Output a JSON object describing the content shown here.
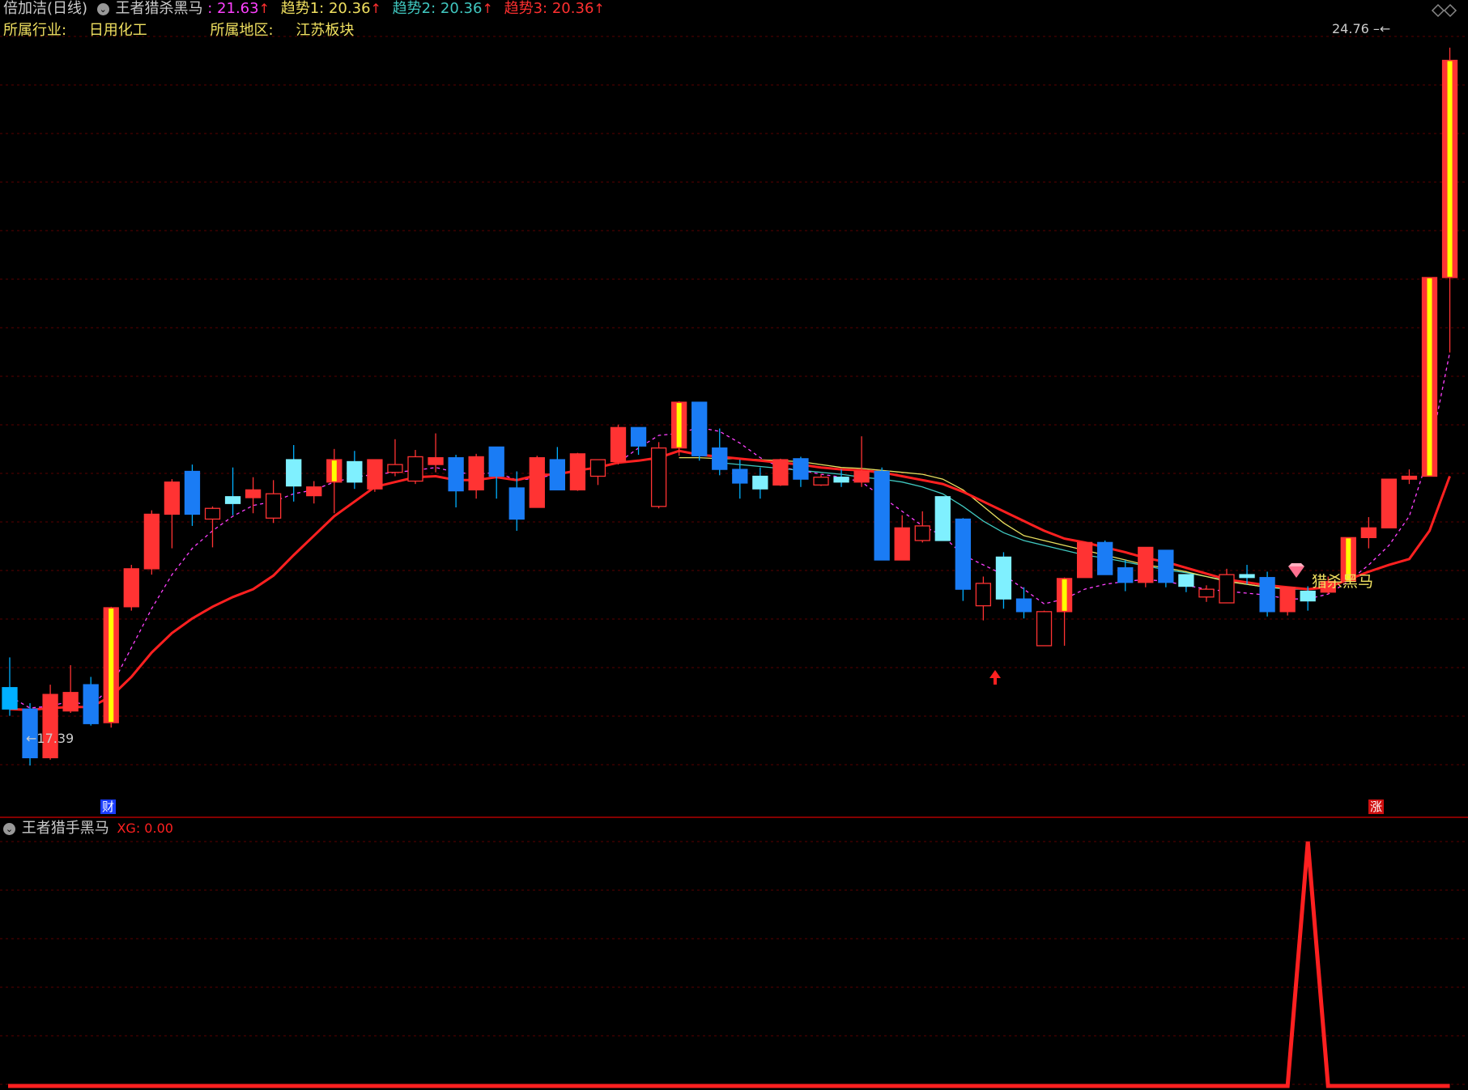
{
  "header": {
    "stock": "倍加洁(日线)",
    "indicator": "王者猎杀黑马",
    "main_value": ": 21.63",
    "trend1_label": "趋势1:",
    "trend1_value": "20.36",
    "trend2_label": "趋势2:",
    "trend2_value": "20.36",
    "trend3_label": "趋势3:",
    "trend3_value": "20.36",
    "up_arrow": "↑"
  },
  "info": {
    "industry_label": "所属行业:",
    "industry_value": "日用化工",
    "region_label": "所属地区:",
    "region_value": "江苏板块"
  },
  "annotations": {
    "high_label": "24.76",
    "low_label": "17.39",
    "signal_label": "猎杀黑马",
    "cai_badge": "财",
    "zhang_badge": "涨",
    "diamond_icon": "diamond-icon"
  },
  "sub_panel": {
    "title": "王者猎手黑马",
    "xg_label": "XG: 0.00"
  },
  "colors": {
    "up": "#ff3333",
    "down": "#00b0ff",
    "down_fill": "#1a7cf5",
    "down_light": "#7ff0ff",
    "limit_up": "#ffff00",
    "ma_red": "#ff2020",
    "ma_yellow": "#e8e060",
    "ma_teal": "#40c8c0",
    "ma_magenta": "#ff40ff",
    "grid": "#5a0000",
    "gold_text": "#f0e060"
  },
  "chart_data": {
    "type": "candlestick",
    "ylim": [
      16.9,
      25.0
    ],
    "sub_ylim": [
      0,
      1
    ],
    "candles": [
      {
        "o": 18.19,
        "h": 18.5,
        "l": 17.9,
        "c": 17.97,
        "k": "down"
      },
      {
        "o": 17.97,
        "h": 18.03,
        "l": 17.39,
        "c": 17.47,
        "k": "downf"
      },
      {
        "o": 17.47,
        "h": 18.22,
        "l": 17.45,
        "c": 18.12,
        "k": "up"
      },
      {
        "o": 18.14,
        "h": 18.42,
        "l": 17.93,
        "c": 17.95,
        "k": "up"
      },
      {
        "o": 18.22,
        "h": 18.3,
        "l": 17.8,
        "c": 17.82,
        "k": "downf"
      },
      {
        "o": 17.83,
        "h": 19.02,
        "l": 17.78,
        "c": 19.01,
        "k": "limit"
      },
      {
        "o": 19.02,
        "h": 19.45,
        "l": 18.98,
        "c": 19.41,
        "k": "up"
      },
      {
        "o": 19.41,
        "h": 20.01,
        "l": 19.35,
        "c": 19.97,
        "k": "up"
      },
      {
        "o": 19.97,
        "h": 20.33,
        "l": 19.62,
        "c": 20.3,
        "k": "up"
      },
      {
        "o": 20.41,
        "h": 20.48,
        "l": 19.85,
        "c": 19.97,
        "k": "downf"
      },
      {
        "o": 19.92,
        "h": 20.05,
        "l": 19.63,
        "c": 20.03,
        "k": "hollow"
      },
      {
        "o": 20.08,
        "h": 20.45,
        "l": 19.96,
        "c": 20.15,
        "k": "downl"
      },
      {
        "o": 20.14,
        "h": 20.35,
        "l": 19.98,
        "c": 20.22,
        "k": "up"
      },
      {
        "o": 19.93,
        "h": 20.32,
        "l": 19.88,
        "c": 20.18,
        "k": "hollow"
      },
      {
        "o": 20.53,
        "h": 20.68,
        "l": 20.1,
        "c": 20.26,
        "k": "downl"
      },
      {
        "o": 20.16,
        "h": 20.31,
        "l": 20.08,
        "c": 20.25,
        "k": "up"
      },
      {
        "o": 20.3,
        "h": 20.64,
        "l": 19.98,
        "c": 20.53,
        "k": "limit"
      },
      {
        "o": 20.51,
        "h": 20.62,
        "l": 20.23,
        "c": 20.3,
        "k": "downl"
      },
      {
        "o": 20.23,
        "h": 20.53,
        "l": 20.2,
        "c": 20.53,
        "k": "up"
      },
      {
        "o": 20.4,
        "h": 20.74,
        "l": 20.36,
        "c": 20.48,
        "k": "hollow"
      },
      {
        "o": 20.31,
        "h": 20.63,
        "l": 20.28,
        "c": 20.56,
        "k": "hollow"
      },
      {
        "o": 20.48,
        "h": 20.8,
        "l": 20.4,
        "c": 20.55,
        "k": "up"
      },
      {
        "o": 20.55,
        "h": 20.58,
        "l": 20.04,
        "c": 20.21,
        "k": "downf"
      },
      {
        "o": 20.22,
        "h": 20.59,
        "l": 20.13,
        "c": 20.56,
        "k": "up"
      },
      {
        "o": 20.66,
        "h": 20.66,
        "l": 20.13,
        "c": 20.36,
        "k": "downf"
      },
      {
        "o": 20.24,
        "h": 20.41,
        "l": 19.8,
        "c": 19.92,
        "k": "downf"
      },
      {
        "o": 20.04,
        "h": 20.57,
        "l": 20.04,
        "c": 20.55,
        "k": "up"
      },
      {
        "o": 20.53,
        "h": 20.66,
        "l": 20.22,
        "c": 20.22,
        "k": "downf"
      },
      {
        "o": 20.22,
        "h": 20.6,
        "l": 20.21,
        "c": 20.59,
        "k": "up"
      },
      {
        "o": 20.36,
        "h": 20.53,
        "l": 20.27,
        "c": 20.53,
        "k": "hollow"
      },
      {
        "o": 20.51,
        "h": 20.89,
        "l": 20.48,
        "c": 20.86,
        "k": "up"
      },
      {
        "o": 20.86,
        "h": 20.86,
        "l": 20.58,
        "c": 20.67,
        "k": "downf"
      },
      {
        "o": 20.05,
        "h": 20.71,
        "l": 20.03,
        "c": 20.65,
        "k": "hollow"
      },
      {
        "o": 20.65,
        "h": 21.13,
        "l": 20.57,
        "c": 21.12,
        "k": "limit"
      },
      {
        "o": 21.12,
        "h": 21.12,
        "l": 20.52,
        "c": 20.57,
        "k": "downf"
      },
      {
        "o": 20.65,
        "h": 20.85,
        "l": 20.37,
        "c": 20.43,
        "k": "downf"
      },
      {
        "o": 20.43,
        "h": 20.53,
        "l": 20.13,
        "c": 20.29,
        "k": "downf"
      },
      {
        "o": 20.36,
        "h": 20.45,
        "l": 20.13,
        "c": 20.23,
        "k": "downl"
      },
      {
        "o": 20.27,
        "h": 20.54,
        "l": 20.26,
        "c": 20.53,
        "k": "up"
      },
      {
        "o": 20.54,
        "h": 20.56,
        "l": 20.25,
        "c": 20.33,
        "k": "downf"
      },
      {
        "o": 20.27,
        "h": 20.38,
        "l": 20.26,
        "c": 20.35,
        "k": "hollow"
      },
      {
        "o": 20.35,
        "h": 20.43,
        "l": 20.25,
        "c": 20.3,
        "k": "downl"
      },
      {
        "o": 20.3,
        "h": 20.77,
        "l": 20.25,
        "c": 20.41,
        "k": "up"
      },
      {
        "o": 20.41,
        "h": 20.45,
        "l": 19.5,
        "c": 19.5,
        "k": "downf"
      },
      {
        "o": 19.5,
        "h": 19.96,
        "l": 19.5,
        "c": 19.83,
        "k": "up"
      },
      {
        "o": 19.7,
        "h": 20.0,
        "l": 19.68,
        "c": 19.85,
        "k": "hollow"
      },
      {
        "o": 20.15,
        "h": 20.15,
        "l": 19.7,
        "c": 19.7,
        "k": "downl"
      },
      {
        "o": 19.92,
        "h": 19.93,
        "l": 19.08,
        "c": 19.2,
        "k": "downf"
      },
      {
        "o": 19.03,
        "h": 19.33,
        "l": 18.88,
        "c": 19.26,
        "k": "hollow"
      },
      {
        "o": 19.53,
        "h": 19.58,
        "l": 19.0,
        "c": 19.1,
        "k": "downl"
      },
      {
        "o": 19.1,
        "h": 19.22,
        "l": 18.9,
        "c": 18.97,
        "k": "downf"
      },
      {
        "o": 18.62,
        "h": 18.98,
        "l": 18.62,
        "c": 18.97,
        "k": "hollow"
      },
      {
        "o": 18.97,
        "h": 19.32,
        "l": 18.62,
        "c": 19.31,
        "k": "limit"
      },
      {
        "o": 19.32,
        "h": 19.67,
        "l": 19.32,
        "c": 19.68,
        "k": "up"
      },
      {
        "o": 19.68,
        "h": 19.7,
        "l": 19.36,
        "c": 19.35,
        "k": "downf"
      },
      {
        "o": 19.42,
        "h": 19.5,
        "l": 19.18,
        "c": 19.27,
        "k": "downf"
      },
      {
        "o": 19.63,
        "h": 19.63,
        "l": 19.22,
        "c": 19.27,
        "k": "up"
      },
      {
        "o": 19.27,
        "h": 19.6,
        "l": 19.22,
        "c": 19.6,
        "k": "downf"
      },
      {
        "o": 19.35,
        "h": 19.35,
        "l": 19.17,
        "c": 19.23,
        "k": "downl"
      },
      {
        "o": 19.12,
        "h": 19.24,
        "l": 19.07,
        "c": 19.2,
        "k": "hollow"
      },
      {
        "o": 19.06,
        "h": 19.41,
        "l": 19.06,
        "c": 19.35,
        "k": "hollow"
      },
      {
        "o": 19.35,
        "h": 19.45,
        "l": 19.25,
        "c": 19.32,
        "k": "downl"
      },
      {
        "o": 19.32,
        "h": 19.38,
        "l": 18.92,
        "c": 18.97,
        "k": "downf"
      },
      {
        "o": 18.97,
        "h": 19.22,
        "l": 18.93,
        "c": 19.22,
        "k": "up"
      },
      {
        "o": 19.18,
        "h": 19.23,
        "l": 18.98,
        "c": 19.08,
        "k": "downl"
      },
      {
        "o": 19.17,
        "h": 19.33,
        "l": 19.15,
        "c": 19.28,
        "k": "up"
      },
      {
        "o": 19.28,
        "h": 19.73,
        "l": 19.28,
        "c": 19.73,
        "k": "limit"
      },
      {
        "o": 19.73,
        "h": 19.94,
        "l": 19.62,
        "c": 19.83,
        "k": "up"
      },
      {
        "o": 19.83,
        "h": 20.33,
        "l": 19.83,
        "c": 20.33,
        "k": "up"
      },
      {
        "o": 20.33,
        "h": 20.43,
        "l": 20.28,
        "c": 20.36,
        "k": "up"
      },
      {
        "o": 20.36,
        "h": 22.4,
        "l": 20.36,
        "c": 22.4,
        "k": "limit"
      },
      {
        "o": 22.4,
        "h": 24.76,
        "l": 21.63,
        "c": 24.63,
        "k": "limit"
      }
    ],
    "ma_red": [
      17.97,
      17.96,
      17.98,
      17.99,
      17.99,
      18.1,
      18.3,
      18.55,
      18.75,
      18.9,
      19.02,
      19.12,
      19.2,
      19.34,
      19.55,
      19.75,
      19.95,
      20.1,
      20.25,
      20.3,
      20.35,
      20.36,
      20.32,
      20.32,
      20.35,
      20.32,
      20.37,
      20.38,
      20.42,
      20.45,
      20.5,
      20.52,
      20.55,
      20.62,
      20.58,
      20.56,
      20.54,
      20.52,
      20.5,
      20.48,
      20.45,
      20.43,
      20.42,
      20.4,
      20.36,
      20.32,
      20.28,
      20.2,
      20.1,
      20.0,
      19.9,
      19.8,
      19.72,
      19.68,
      19.63,
      19.58,
      19.52,
      19.48,
      19.42,
      19.36,
      19.3,
      19.27,
      19.24,
      19.22,
      19.2,
      19.22,
      19.3,
      19.38,
      19.45,
      19.51,
      19.8,
      20.36
    ],
    "ma_yellow": [
      null,
      null,
      null,
      null,
      null,
      null,
      null,
      null,
      null,
      null,
      null,
      null,
      null,
      null,
      null,
      null,
      null,
      null,
      null,
      null,
      null,
      null,
      null,
      null,
      null,
      null,
      null,
      null,
      null,
      null,
      null,
      null,
      null,
      20.55,
      20.55,
      20.54,
      20.54,
      20.53,
      20.52,
      20.51,
      20.48,
      20.45,
      20.44,
      20.42,
      20.4,
      20.38,
      20.33,
      20.22,
      20.05,
      19.88,
      19.75,
      19.7,
      19.65,
      19.6,
      19.55,
      19.5,
      19.45,
      19.42,
      19.38,
      19.33,
      19.28,
      19.25,
      19.22,
      19.21,
      19.2,
      19.22,
      null,
      null,
      null,
      null,
      null,
      null
    ],
    "ma_teal": [
      null,
      null,
      null,
      null,
      null,
      null,
      null,
      null,
      null,
      null,
      null,
      null,
      null,
      null,
      null,
      null,
      null,
      null,
      null,
      null,
      null,
      null,
      null,
      null,
      null,
      null,
      null,
      null,
      null,
      null,
      null,
      null,
      null,
      null,
      null,
      20.5,
      20.48,
      20.46,
      20.44,
      20.42,
      20.4,
      20.38,
      20.35,
      20.33,
      20.3,
      20.25,
      20.18,
      20.05,
      19.9,
      19.78,
      19.7,
      19.65,
      19.6,
      19.55,
      19.52,
      19.48,
      19.44,
      19.4,
      19.37,
      19.33,
      19.29,
      19.25,
      19.22,
      19.2,
      19.2,
      null,
      null,
      null,
      null,
      null,
      null,
      null
    ],
    "ma_magenta": [
      18.1,
      17.98,
      18.0,
      18.05,
      18.0,
      18.2,
      18.6,
      19.0,
      19.35,
      19.62,
      19.8,
      19.95,
      20.06,
      20.1,
      20.18,
      20.22,
      20.3,
      20.35,
      20.38,
      20.4,
      20.42,
      20.45,
      20.4,
      20.38,
      20.4,
      20.32,
      20.34,
      20.38,
      20.42,
      20.45,
      20.5,
      20.65,
      20.78,
      20.8,
      20.86,
      20.82,
      20.7,
      20.55,
      20.45,
      20.42,
      20.38,
      20.35,
      20.3,
      20.15,
      20.0,
      19.85,
      19.75,
      19.55,
      19.45,
      19.35,
      19.2,
      19.05,
      19.1,
      19.2,
      19.25,
      19.28,
      19.3,
      19.28,
      19.24,
      19.2,
      19.18,
      19.16,
      19.14,
      19.1,
      19.1,
      19.15,
      19.28,
      19.45,
      19.65,
      19.95,
      20.6,
      21.63
    ],
    "xg_signal_index": 64
  }
}
